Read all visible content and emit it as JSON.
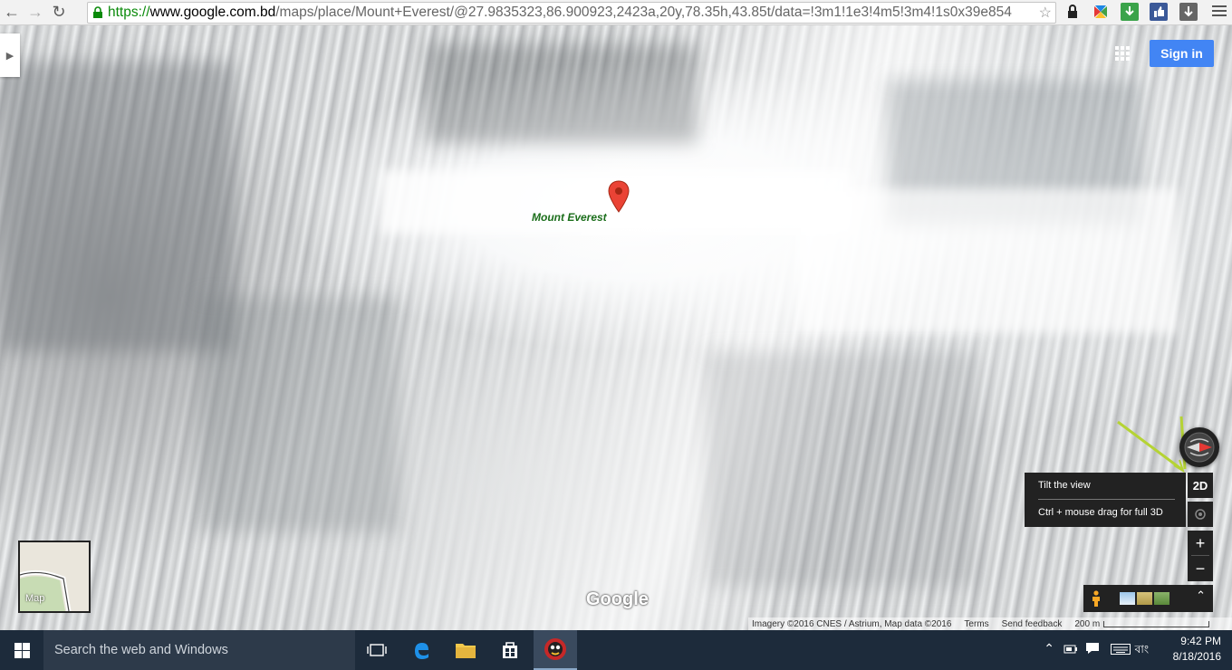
{
  "browser": {
    "url_scheme": "https://",
    "url_host": "www.google.com.bd",
    "url_path": "/maps/place/Mount+Everest/@27.9835323,86.900923,2423a,20y,78.35h,43.85t/data=!3m1!1e3!4m5!3m4!1s0x39e854"
  },
  "header": {
    "signin_label": "Sign in"
  },
  "map": {
    "place_label": "Mount Everest",
    "minimap_label": "Map",
    "logo_text": "Google",
    "tooltip_title": "Tilt the view",
    "tooltip_hint": "Ctrl + mouse drag for full 3D",
    "tilt_label": "2D",
    "zoom_in_label": "+",
    "zoom_out_label": "−",
    "footer": {
      "attribution": "Imagery ©2016 CNES / Astrium, Map data ©2016",
      "terms": "Terms",
      "feedback": "Send feedback",
      "scale": "200 m"
    }
  },
  "taskbar": {
    "search_placeholder": "Search the web and Windows",
    "language": "বাং",
    "time": "9:42 PM",
    "date": "8/18/2016"
  },
  "colors": {
    "signin_blue": "#4285f4",
    "pin_red": "#ea4335",
    "arrow_green": "#b5d334",
    "taskbar": "#1d2b3b"
  }
}
